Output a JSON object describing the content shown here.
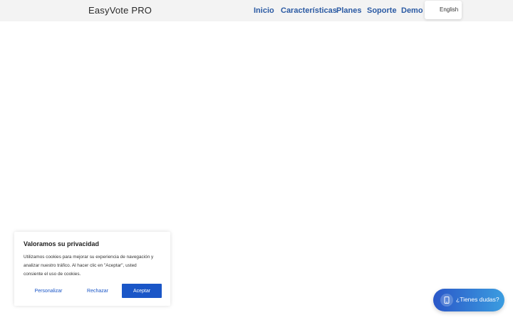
{
  "header": {
    "brand": "EasyVote PRO",
    "nav": [
      {
        "label": "Inicio"
      },
      {
        "label": "Características"
      },
      {
        "label": "Planes"
      },
      {
        "label": "Soporte"
      },
      {
        "label": "Demo"
      }
    ],
    "language": {
      "label": "English"
    }
  },
  "cookie_banner": {
    "title": "Valoramos su privacidad",
    "text": "Utilizamos cookies para mejorar su experiencia de navegación y analizar nuestro tráfico. Al hacer clic en \"Aceptar\", usted consiente el uso de cookies.",
    "customize_label": "Personalizar",
    "reject_label": "Rechazar",
    "accept_label": "Aceptar"
  },
  "help_widget": {
    "label": "¿Tienes dudas?",
    "icon": "phone-icon"
  },
  "colors": {
    "accent": "#1a56c7",
    "nav": "#2b5aa3",
    "header_bg": "#f3f3f3"
  }
}
